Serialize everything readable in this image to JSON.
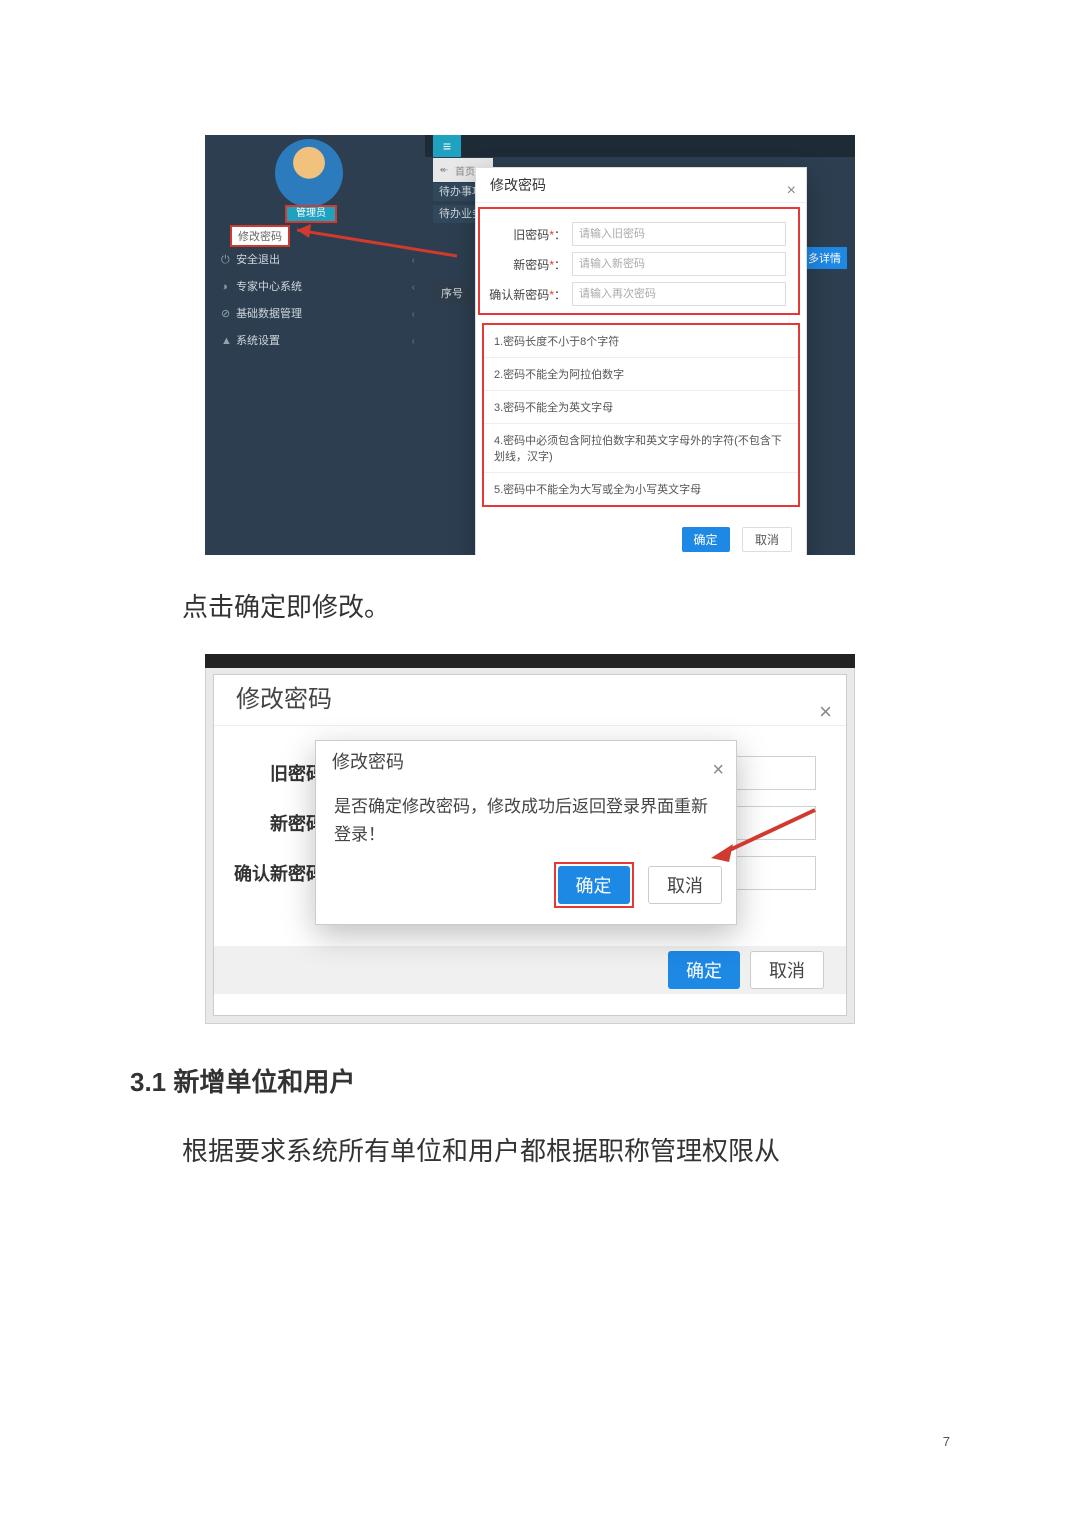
{
  "page_number": "7",
  "para1": "点击确定即修改。",
  "heading": "3.1 新增单位和用户",
  "para2": "根据要求系统所有单位和用户都根据职称管理权限从",
  "shot1": {
    "hamburger_glyph": "≡",
    "crumb_back": "↞",
    "crumb_home": "首页",
    "avatar_badge": "管理员",
    "change_pw_link": "修改密码",
    "menu": {
      "safe_exit": "安全退出",
      "expert_center": "专家中心系统",
      "base_data": "基础数据管理",
      "sys_settings": "系统设置"
    },
    "tabs": {
      "t1": "待办事项",
      "t2": "待办业务"
    },
    "table_head": "序号",
    "more_btn": "!多详情",
    "dialog": {
      "title": "修改密码",
      "labels": {
        "old": "旧密码",
        "new": "新密码",
        "confirm": "确认新密码"
      },
      "placeholders": {
        "old": "请输入旧密码",
        "new": "请输入新密码",
        "confirm": "请输入再次密码"
      },
      "req": "*",
      "colon": "：",
      "rules": [
        "1.密码长度不小于8个字符",
        "2.密码不能全为阿拉伯数字",
        "3.密码不能全为英文字母",
        "4.密码中必须包含阿拉伯数字和英文字母外的字符(不包含下划线，汉字)",
        "5.密码中不能全为大写或全为小写英文字母"
      ],
      "ok": "确定",
      "cancel": "取消"
    }
  },
  "shot2": {
    "outer_title": "修改密码",
    "labels": {
      "old": "旧密码",
      "new": "新密码",
      "confirm": "确认新密码"
    },
    "confirm_dialog": {
      "title": "修改密码",
      "message": "是否确定修改密码，修改成功后返回登录界面重新登录！",
      "ok": "确定",
      "cancel": "取消"
    },
    "ok": "确定",
    "cancel": "取消"
  }
}
